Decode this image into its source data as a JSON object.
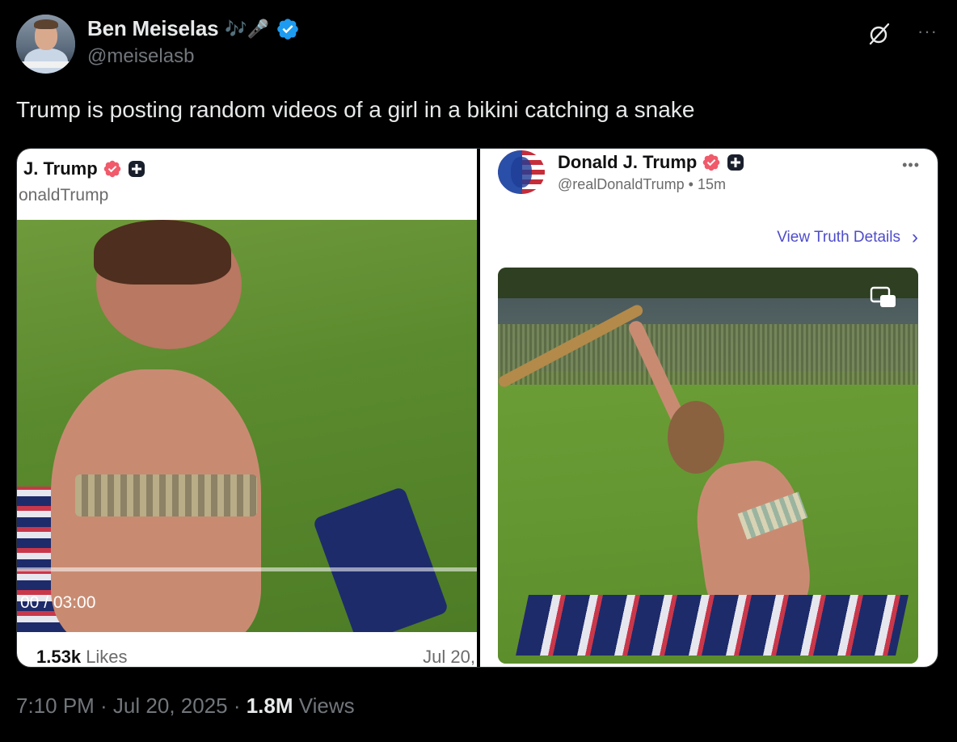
{
  "author": {
    "display_name": "Ben Meiselas",
    "name_emoji": "🎶🎤",
    "handle": "@meiselasb",
    "verified": true,
    "verified_color": "#1d9bf0"
  },
  "header_actions": {
    "grok_icon": "grok-icon",
    "more_label": "···"
  },
  "tweet": {
    "text": "Trump is posting random videos of a girl in a bikini catching a snake"
  },
  "media": {
    "left": {
      "name": "J. Trump",
      "handle": "onaldTrump",
      "video_time": "00 / 03:00",
      "likes_count": "1.53k",
      "likes_label": "Likes",
      "date": "Jul 20,"
    },
    "right": {
      "name": "Donald J. Trump",
      "handle_time": "@realDonaldTrump • 15m",
      "more_label": "•••",
      "view_details_label": "View Truth Details",
      "accent_color": "#4e4cc9"
    }
  },
  "footer": {
    "time": "7:10 PM · Jul 20, 2025 · ",
    "views_count": "1.8M",
    "views_label": " Views"
  }
}
